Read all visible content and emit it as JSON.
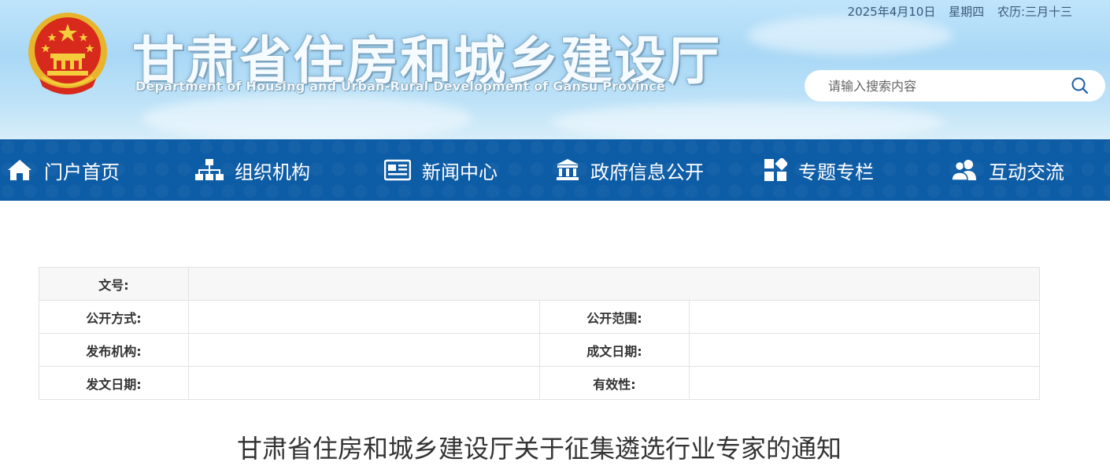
{
  "header": {
    "site_title": "甘肃省住房和城乡建设厅",
    "site_subtitle": "Department of Housing and Urban-Rural Development of Gansu Province",
    "date": "2025年4月10日",
    "weekday": "星期四",
    "lunar": "农历:三月十三",
    "search_placeholder": "请输入搜索内容"
  },
  "nav": {
    "items": [
      {
        "label": "门户首页",
        "icon": "home-icon"
      },
      {
        "label": "组织机构",
        "icon": "org-chart-icon"
      },
      {
        "label": "新闻中心",
        "icon": "newspaper-icon"
      },
      {
        "label": "政府信息公开",
        "icon": "government-building-icon"
      },
      {
        "label": "专题专栏",
        "icon": "grid-icon"
      },
      {
        "label": "互动交流",
        "icon": "users-icon"
      }
    ]
  },
  "info_table": {
    "doc_number_label": "文号:",
    "doc_number_value": "",
    "disclosure_method_label": "公开方式:",
    "disclosure_method_value": "",
    "disclosure_scope_label": "公开范围:",
    "disclosure_scope_value": "",
    "issuer_label": "发布机构:",
    "issuer_value": "",
    "written_date_label": "成文日期:",
    "written_date_value": "",
    "issue_date_label": "发文日期:",
    "issue_date_value": "",
    "validity_label": "有效性:",
    "validity_value": ""
  },
  "article": {
    "title": "甘肃省住房和城乡建设厅关于征集遴选行业专家的通知"
  },
  "colors": {
    "nav_bg": "#0d5ca6",
    "header_sky": "#a9d8f6"
  }
}
